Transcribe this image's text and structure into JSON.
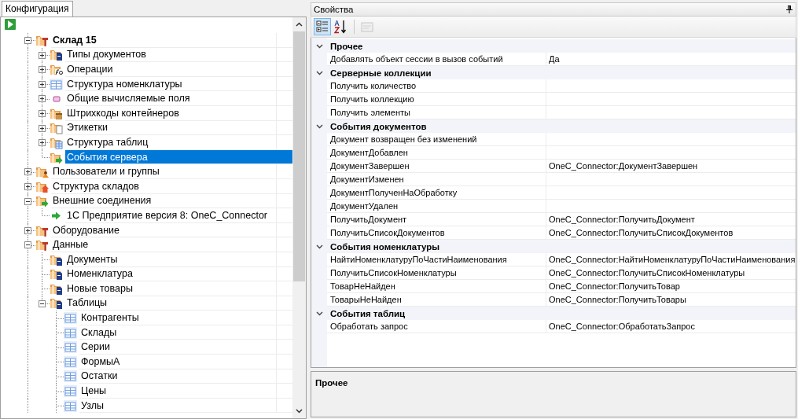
{
  "left_tab": {
    "label": "Конфигурация",
    "selected": true
  },
  "tree": [
    {
      "label": "Склад 15",
      "kind": "folder-tool",
      "bold": true,
      "expanded": true,
      "selected": false,
      "children": [
        {
          "label": "Типы документов",
          "kind": "folder-doc",
          "expanded": false,
          "selected": false
        },
        {
          "label": "Операции",
          "kind": "folder-fx",
          "expanded": false,
          "selected": false
        },
        {
          "label": "Структура номенклатуры",
          "kind": "table",
          "expanded": false,
          "selected": false
        },
        {
          "label": "Общие вычисляемые поля",
          "kind": "form",
          "expanded": false,
          "selected": false
        },
        {
          "label": "Штрихкоды контейнеров",
          "kind": "folder-box",
          "expanded": false,
          "selected": false
        },
        {
          "label": "Этикетки",
          "kind": "folder-label",
          "expanded": false,
          "selected": false
        },
        {
          "label": "Структура таблиц",
          "kind": "folder-table",
          "expanded": false,
          "selected": false
        },
        {
          "label": "События сервера",
          "kind": "folder-arrow",
          "selected": true
        }
      ]
    },
    {
      "label": "Пользователи и группы",
      "kind": "folder-users",
      "expanded": false,
      "selected": false
    },
    {
      "label": "Структура складов",
      "kind": "folder-house",
      "expanded": false,
      "selected": false
    },
    {
      "label": "Внешние соединения",
      "kind": "folder-arrow",
      "expanded": true,
      "selected": false,
      "children": [
        {
          "label": "1С Предприятие версия 8: OneC_Connector",
          "kind": "arrow",
          "selected": false
        }
      ]
    },
    {
      "label": "Оборудование",
      "kind": "folder-tool",
      "expanded": false,
      "selected": false
    },
    {
      "label": "Данные",
      "kind": "folder-tool",
      "expanded": true,
      "selected": false,
      "children": [
        {
          "label": "Документы",
          "kind": "folder-doc",
          "selected": false
        },
        {
          "label": "Номенклатура",
          "kind": "folder-doc",
          "selected": false
        },
        {
          "label": "Новые товары",
          "kind": "folder-doc",
          "selected": false
        },
        {
          "label": "Таблицы",
          "kind": "folder-doc",
          "expanded": true,
          "selected": false,
          "children": [
            {
              "label": "Контрагенты",
              "kind": "table",
              "selected": false
            },
            {
              "label": "Склады",
              "kind": "table",
              "selected": false
            },
            {
              "label": "Серии",
              "kind": "table",
              "selected": false
            },
            {
              "label": "ФормыА",
              "kind": "table",
              "selected": false
            },
            {
              "label": "Остатки",
              "kind": "table",
              "selected": false
            },
            {
              "label": "Цены",
              "kind": "table",
              "selected": false
            },
            {
              "label": "Узлы",
              "kind": "table",
              "selected": false
            }
          ]
        }
      ]
    }
  ],
  "properties": {
    "title": "Свойства",
    "toolbar": [
      {
        "kind": "categorized",
        "selected": true,
        "disabled": false
      },
      {
        "kind": "alphabetical",
        "selected": false,
        "disabled": false
      },
      {
        "kind": "property-pages",
        "selected": false,
        "disabled": true
      }
    ],
    "categories": [
      {
        "name": "Прочее",
        "expanded": true,
        "rows": [
          {
            "name": "Добавлять объект сессии в вызов событий",
            "value": "Да"
          }
        ]
      },
      {
        "name": "Серверные коллекции",
        "expanded": true,
        "rows": [
          {
            "name": "Получить количество"
          },
          {
            "name": "Получить коллекцию"
          },
          {
            "name": "Получить элементы"
          }
        ]
      },
      {
        "name": "События документов",
        "expanded": true,
        "rows": [
          {
            "name": "Документ возвращен без изменений"
          },
          {
            "name": "ДокументДобавлен"
          },
          {
            "name": "ДокументЗавершен",
            "value": "OneC_Connector:ДокументЗавершен"
          },
          {
            "name": "ДокументИзменен"
          },
          {
            "name": "ДокументПолученНаОбработку"
          },
          {
            "name": "ДокументУдален"
          },
          {
            "name": "ПолучитьДокумент",
            "value": "OneC_Connector:ПолучитьДокумент"
          },
          {
            "name": "ПолучитьСписокДокументов",
            "value": "OneC_Connector:ПолучитьСписокДокументов"
          }
        ]
      },
      {
        "name": "События номенклатуры",
        "expanded": true,
        "rows": [
          {
            "name": "НайтиНоменклатуруПоЧастиНаименования",
            "value": "OneC_Connector:НайтиНоменклатуруПоЧастиНаименования"
          },
          {
            "name": "ПолучитьСписокНоменклатуры",
            "value": "OneC_Connector:ПолучитьСписокНоменклатуры"
          },
          {
            "name": "ТоварНеНайден",
            "value": "OneC_Connector:ПолучитьТовар"
          },
          {
            "name": "ТоварыНеНайден",
            "value": "OneC_Connector:ПолучитьТовары"
          }
        ]
      },
      {
        "name": "События таблиц",
        "expanded": true,
        "rows": [
          {
            "name": "Обработать запрос",
            "value": "OneC_Connector:ОбработатьЗапрос"
          }
        ]
      }
    ],
    "description": {
      "title": "Прочее"
    }
  }
}
